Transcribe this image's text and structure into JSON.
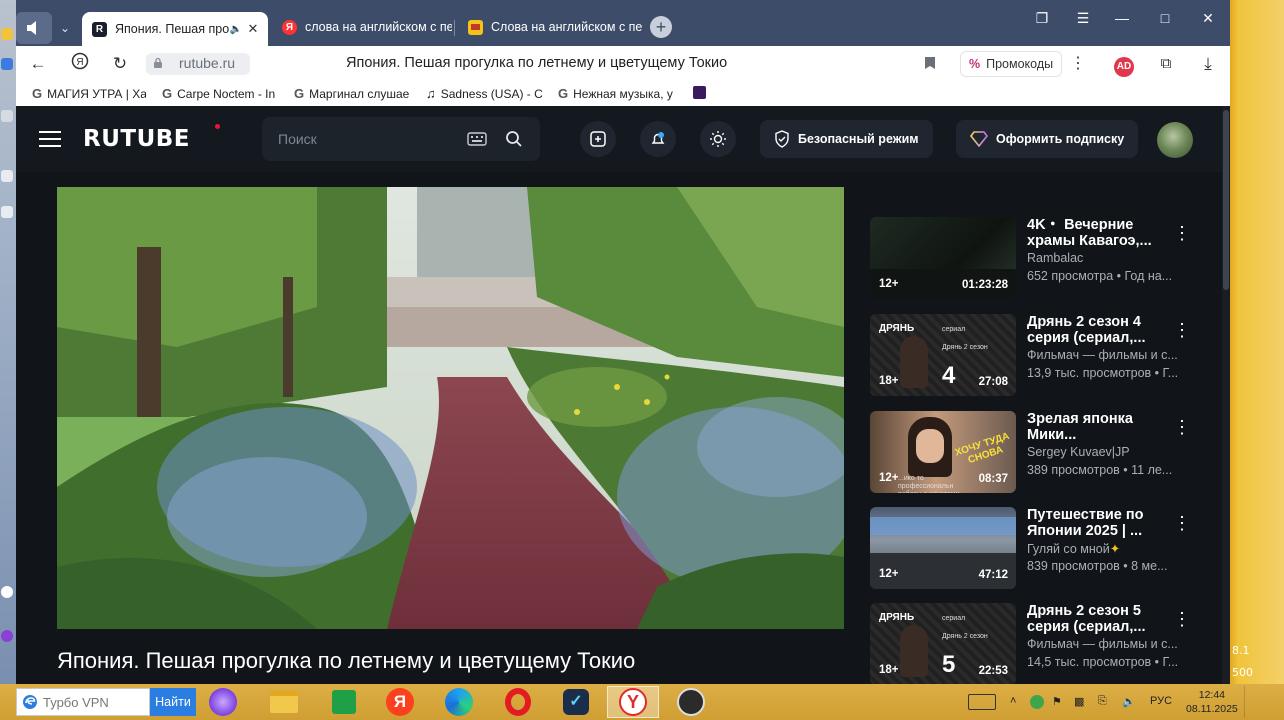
{
  "browser": {
    "tabs": [
      {
        "title": "Япония. Пешая прог",
        "favicon": "rutube",
        "audio": true,
        "active": true
      },
      {
        "title": "слова на английском с пе",
        "favicon": "yandex"
      },
      {
        "title": "Слова на английском с пе",
        "favicon": "yellow-doc"
      }
    ],
    "address": {
      "url": "rutube.ru",
      "page_title": "Япония. Пешая прогулка по летнему и цветущему Токио",
      "promo_label": "Промокоды"
    },
    "bookmarks": [
      {
        "label": "МАГИЯ УТРА | Ха",
        "icon": "google"
      },
      {
        "label": "Carpe Noctem - In",
        "icon": "google"
      },
      {
        "label": "Маргинал слушае",
        "icon": "google"
      },
      {
        "label": "Sadness (USA) - C",
        "icon": "music"
      },
      {
        "label": "Нежная музыка, у",
        "icon": "google"
      }
    ]
  },
  "rutube": {
    "logo": "RUTUBE",
    "search_placeholder": "Поиск",
    "safe_mode_label": "Безопасный режим",
    "subscribe_label": "Оформить подписку",
    "video_title": "Япония. Пешая прогулка по летнему и цветущему Токио",
    "recommendations": [
      {
        "title": "4K・ Вечерние храмы Кавагоэ,...",
        "channel": "Rambalac",
        "meta": "652 просмотра • Год на...",
        "age": "12+",
        "duration": "01:23:28"
      },
      {
        "title": "Дрянь 2 сезон 4 серия (сериал,...",
        "channel": "Фильмач — фильмы и с...",
        "meta": "13,9 тыс. просмотров • Г...",
        "age": "18+",
        "duration": "27:08",
        "thumb_brand": "ДРЯНЬ",
        "thumb_label": "сериал",
        "thumb_sub": "Дрянь 2 сезон",
        "episode": "4"
      },
      {
        "title": "Зрелая японка Мики...",
        "channel": "Sergey Kuvaev|JP",
        "meta": "389 просмотров • 11 ле...",
        "age": "12+",
        "duration": "08:37",
        "thumb_caption": "ХОЧУ ТУДА СНОВА",
        "thumb_small": "...ико то профессиональн работы с кинатами"
      },
      {
        "title": "Путешествие по Японии 2025 | ...",
        "channel": "Гуляй со мной",
        "meta": "839 просмотров • 8 ме...",
        "age": "12+",
        "duration": "47:12"
      },
      {
        "title": "Дрянь 2 сезон 5 серия (сериал,...",
        "channel": "Фильмач — фильмы и с...",
        "meta": "14,5 тыс. просмотров • Г...",
        "age": "18+",
        "duration": "22:53",
        "thumb_brand": "ДРЯНЬ",
        "thumb_label": "сериал",
        "thumb_sub": "Дрянь 2 сезон",
        "episode": "5"
      }
    ]
  },
  "desktop": {
    "right_texts": [
      "8.1",
      "500"
    ]
  },
  "taskbar": {
    "search_placeholder": "Турбо VPN",
    "find_label": "Найти",
    "language": "РУС",
    "time": "12:44",
    "date": "08.11.2025"
  },
  "colors": {
    "rutube_bg": "#14191f",
    "rutube_red": "#ed143b",
    "tabbar": "#3d4c68",
    "taskbar": "#d4a53a"
  }
}
